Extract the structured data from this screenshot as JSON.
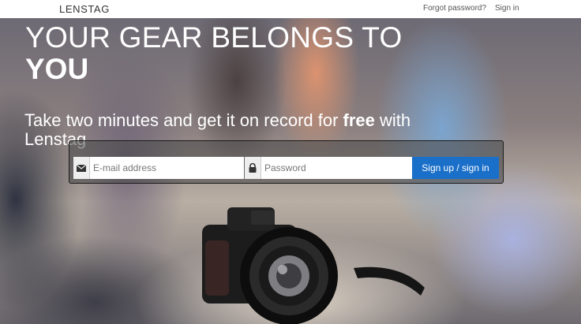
{
  "navbar": {
    "brand": "LENSTAG",
    "forgot_password": "Forgot password?",
    "sign_in": "Sign in"
  },
  "hero": {
    "headline_line1": "YOUR GEAR BELONGS TO",
    "headline_line2": "YOU",
    "subline_before": "Take two minutes and get it on record for ",
    "subline_bold": "free",
    "subline_after": " with Lenstag"
  },
  "signup_form": {
    "email_placeholder": "E-mail address",
    "password_placeholder": "Password",
    "submit_label": "Sign up / sign in",
    "email_icon": "envelope-icon",
    "password_icon": "lock-icon"
  },
  "colors": {
    "accent": "#1a6fc9",
    "navbar_bg": "#ffffff",
    "hero_text": "#ffffff"
  }
}
